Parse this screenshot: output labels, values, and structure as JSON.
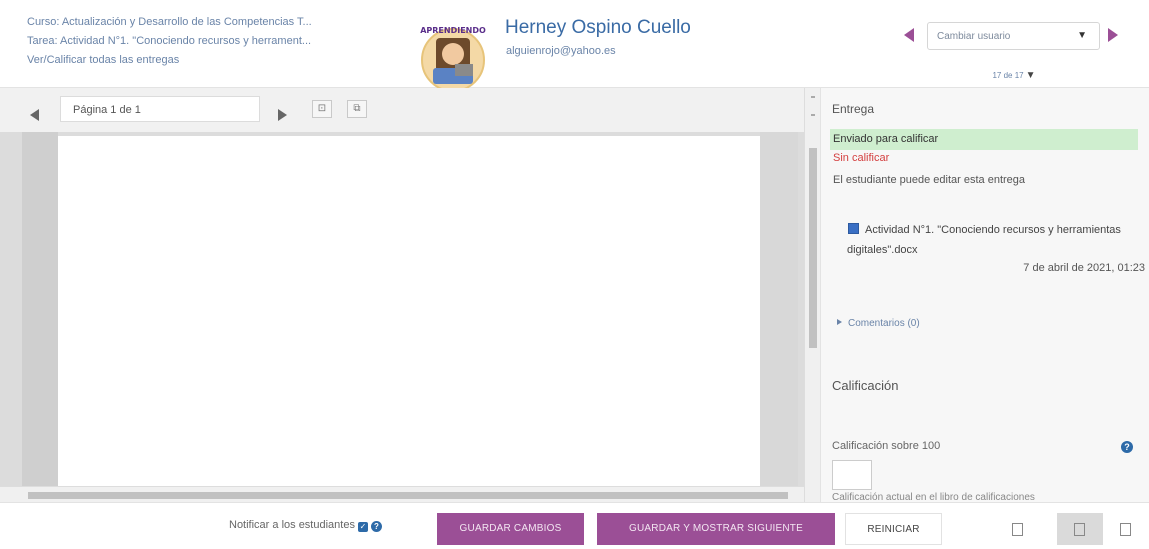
{
  "header": {
    "course_line": "Curso: Actualización y Desarrollo de las Competencias T...",
    "task_line": "Tarea: Actividad N°1. \"Conociendo recursos y herrament...",
    "view_all_link": "Ver/Calificar todas las entregas",
    "user_name": "Herney Ospino Cuello",
    "user_email": "alguienrojo@yahoo.es",
    "change_user_placeholder": "Cambiar usuario",
    "user_count": "17 de 17",
    "avatar_banner": "APRENDIENDO"
  },
  "viewer": {
    "page_label": "Página 1 de 1"
  },
  "side": {
    "title": "Entrega",
    "status_sent": "Enviado para calificar",
    "status_grade": "Sin calificar",
    "status_edit": "El estudiante puede editar esta entrega",
    "file_name": "Actividad N°1. \"Conociendo recursos y herramientas digitales\".docx",
    "file_date": "7 de abril de 2021, 01:23",
    "comments": "Comentarios (0)",
    "grade_title": "Calificación",
    "grade_label": "Calificación sobre 100",
    "grade_current": "Calificación actual en el libro de calificaciones"
  },
  "footer": {
    "notify_label": "Notificar a los estudiantes",
    "save_label": "GUARDAR CAMBIOS",
    "save_next_label": "GUARDAR Y MOSTRAR SIGUIENTE",
    "reset_label": "REINICIAR"
  },
  "colors": {
    "accent": "#9b4f96",
    "link": "#6a84a8",
    "name": "#3a6ba5",
    "success_bg": "#cfeecf",
    "danger": "#d43f3f"
  }
}
